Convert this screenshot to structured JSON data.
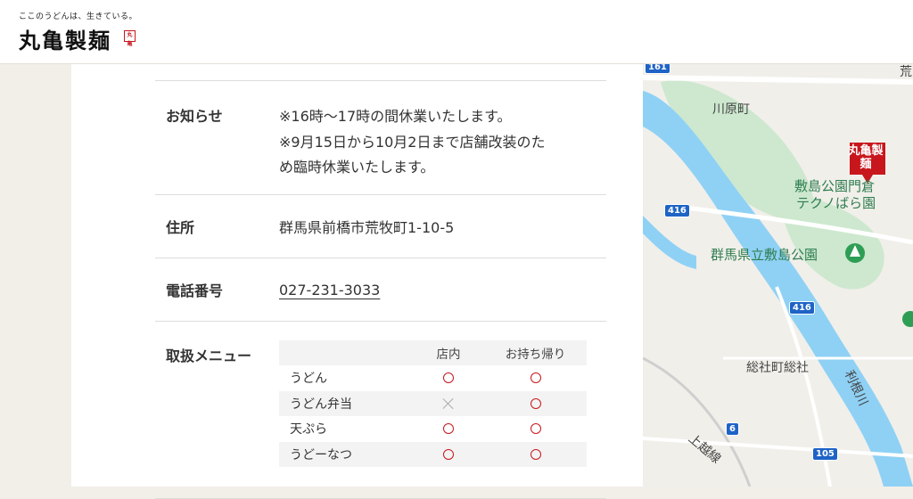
{
  "header": {
    "tagline": "ここのうどんは、生きている。",
    "logo": "丸亀製麺",
    "seal": "丸亀"
  },
  "store_info": {
    "notice": {
      "label": "お知らせ",
      "lines": [
        "※16時〜17時の間休業いたします。",
        "※9月15日から10月2日まで店舗改装のた",
        "め臨時休業いたします。"
      ]
    },
    "address": {
      "label": "住所",
      "value": "群馬県前橋市荒牧町1-10-5"
    },
    "phone": {
      "label": "電話番号",
      "value": "027-231-3033"
    },
    "menu": {
      "label": "取扱メニュー",
      "columns": [
        "",
        "店内",
        "お持ち帰り"
      ],
      "rows": [
        {
          "name": "うどん",
          "dine_in": "available",
          "takeout": "available"
        },
        {
          "name": "うどん弁当",
          "dine_in": "unavailable",
          "takeout": "available"
        },
        {
          "name": "天ぷら",
          "dine_in": "available",
          "takeout": "available"
        },
        {
          "name": "うどーなつ",
          "dine_in": "available",
          "takeout": "available"
        }
      ]
    }
  },
  "map": {
    "marker_text": "丸亀製麺",
    "labels": {
      "kawaharacho": "川原町",
      "shikishima_park_top": "敷島公園門倉",
      "techno_rose": "テクノばら園",
      "gunma_park": "群馬県立敷島公園",
      "sojamachi": "総社町総社",
      "tone_river": "利根川",
      "joetsu_line": "上越線",
      "ara": "荒"
    },
    "route_shields": [
      "161",
      "416",
      "416",
      "6",
      "105"
    ]
  }
}
